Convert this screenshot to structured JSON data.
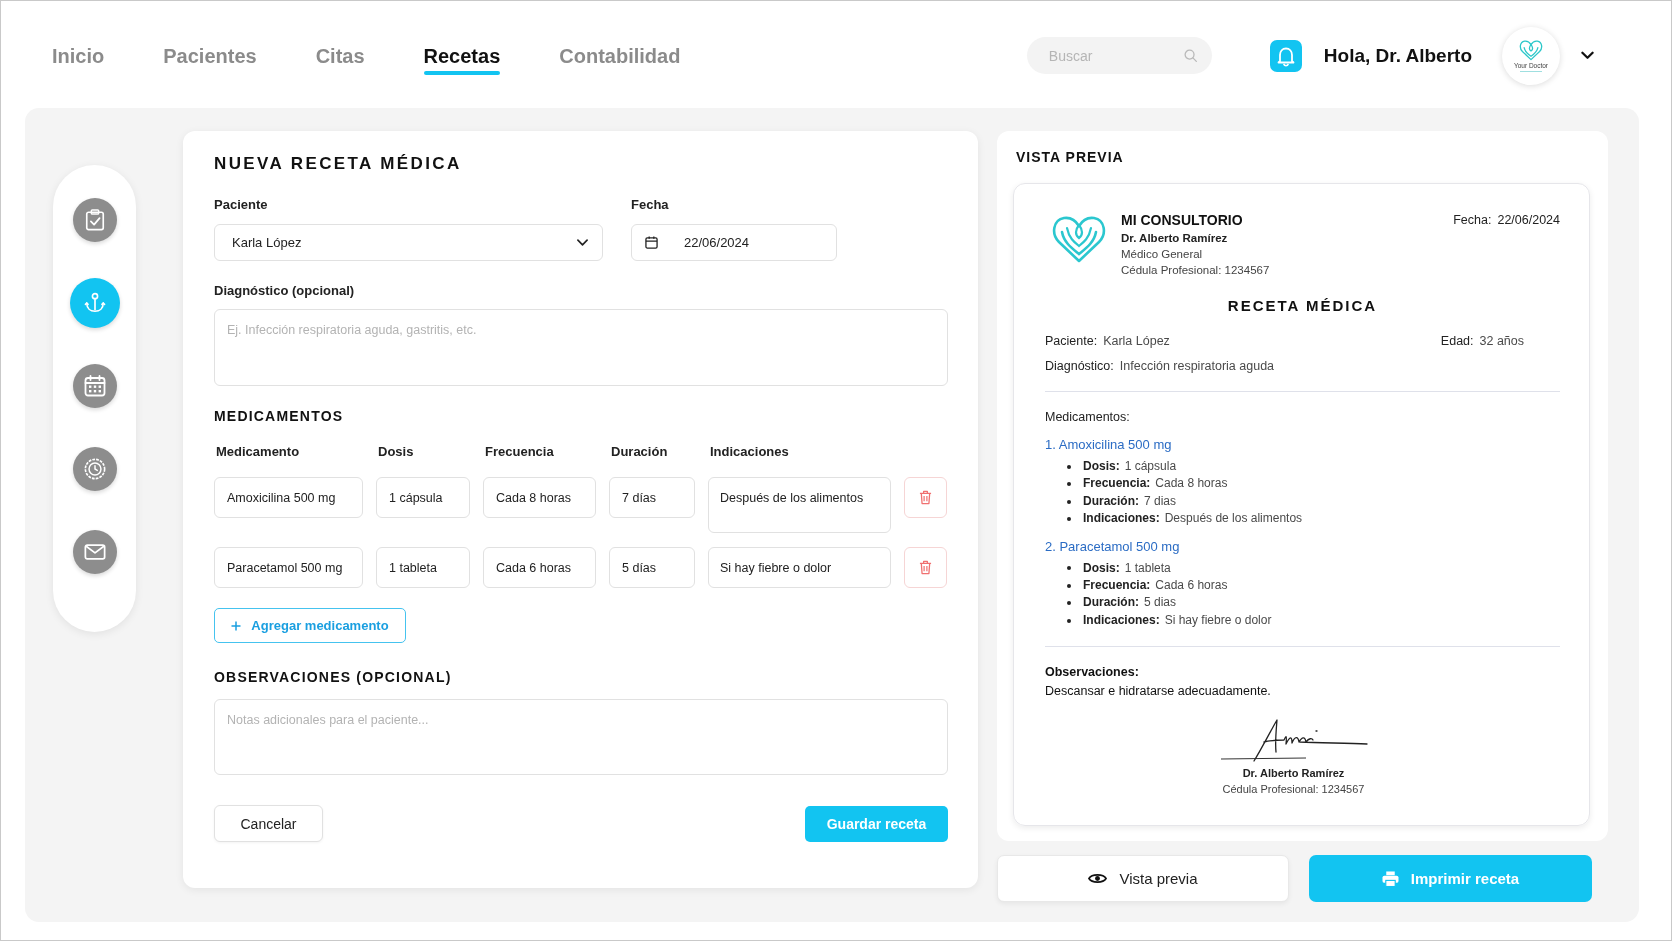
{
  "header": {
    "tabs": [
      {
        "label": "Inicio",
        "selected": false
      },
      {
        "label": "Pacientes",
        "selected": false
      },
      {
        "label": "Citas",
        "selected": false
      },
      {
        "label": "Recetas",
        "selected": true
      },
      {
        "label": "Contabilidad",
        "selected": false
      }
    ],
    "search": {
      "placeholder": "Buscar"
    },
    "greeting": "Hola, Dr. Alberto",
    "avatar_caption": "Your Doctor"
  },
  "sidebar": {
    "items": [
      {
        "kind": "clipboard",
        "selected": false
      },
      {
        "kind": "anchor",
        "selected": true
      },
      {
        "kind": "calendar",
        "selected": false
      },
      {
        "kind": "clock",
        "selected": false
      },
      {
        "kind": "mail",
        "selected": false
      }
    ]
  },
  "form": {
    "title": "NUEVA RECETA MÉDICA",
    "patient": {
      "label": "Paciente",
      "value": "Karla López"
    },
    "date": {
      "label": "Fecha",
      "value": "22/06/2024"
    },
    "diagnosis": {
      "label": "Diagnóstico (opcional)",
      "placeholder": "Ej. Infección respiratoria aguda, gastritis, etc."
    },
    "medications": {
      "title": "MEDICAMENTOS",
      "columns": [
        "Medicamento",
        "Dosis",
        "Frecuencia",
        "Duración",
        "Indicaciones"
      ],
      "rows": [
        {
          "medication": "Amoxicilina 500 mg",
          "dose": "1 cápsula",
          "frequency": "Cada 8 horas",
          "duration": "7 días",
          "instructions": "Después de los alimentos"
        },
        {
          "medication": "Paracetamol 500 mg",
          "dose": "1 tableta",
          "frequency": "Cada 6 horas",
          "duration": "5 días",
          "instructions": "Si hay fiebre o dolor"
        }
      ],
      "add_button": "Agregar medicamento"
    },
    "observations": {
      "title": "OBSERVACIONES (OPCIONAL)",
      "placeholder": "Notas adicionales para el paciente..."
    },
    "cancel_button": "Cancelar",
    "save_button": "Guardar receta"
  },
  "preview": {
    "title": "VISTA PREVIA",
    "document": {
      "clinic": "MI CONSULTORIO",
      "doctor": "Dr. Alberto Ramírez",
      "specialty": "Médico General",
      "license": "Cédula Profesional: 1234567",
      "date": {
        "label": "Fecha:",
        "value": "22/06/2024"
      },
      "heading": "RECETA MÉDICA",
      "patient": {
        "label": "Paciente:",
        "value": "Karla López"
      },
      "age": {
        "label": "Edad:",
        "value": "32 años"
      },
      "diagnosis": {
        "label": "Diagnóstico:",
        "value": "Infección respiratoria aguda"
      },
      "medications_label": "Medicamentos:",
      "medications": [
        {
          "title": "1. Amoxicilina 500 mg",
          "details": [
            {
              "label": "Dosis:",
              "value": "1 cápsula"
            },
            {
              "label": "Frecuencia:",
              "value": "Cada 8 horas"
            },
            {
              "label": "Duración:",
              "value": "7 dias"
            },
            {
              "label": "Indicaciones:",
              "value": "Después de los alimentos"
            }
          ]
        },
        {
          "title": "2. Paracetamol 500 mg",
          "details": [
            {
              "label": "Dosis:",
              "value": "1 tableta"
            },
            {
              "label": "Frecuencia:",
              "value": "Cada 6 horas"
            },
            {
              "label": "Duración:",
              "value": "5 dias"
            },
            {
              "label": "Indicaciones:",
              "value": "Si hay fiebre o dolor"
            }
          ]
        }
      ],
      "observations": {
        "label": "Observaciones:",
        "text": "Descansar e hidratarse adecuadamente."
      },
      "signature": {
        "name": "Dr. Alberto Ramírez",
        "license": "Cédula Profesional: 1234567"
      }
    },
    "buttons": [
      {
        "kind": "preview",
        "label": "Vista previa"
      },
      {
        "kind": "print",
        "label": "Imprimir receta"
      }
    ]
  }
}
